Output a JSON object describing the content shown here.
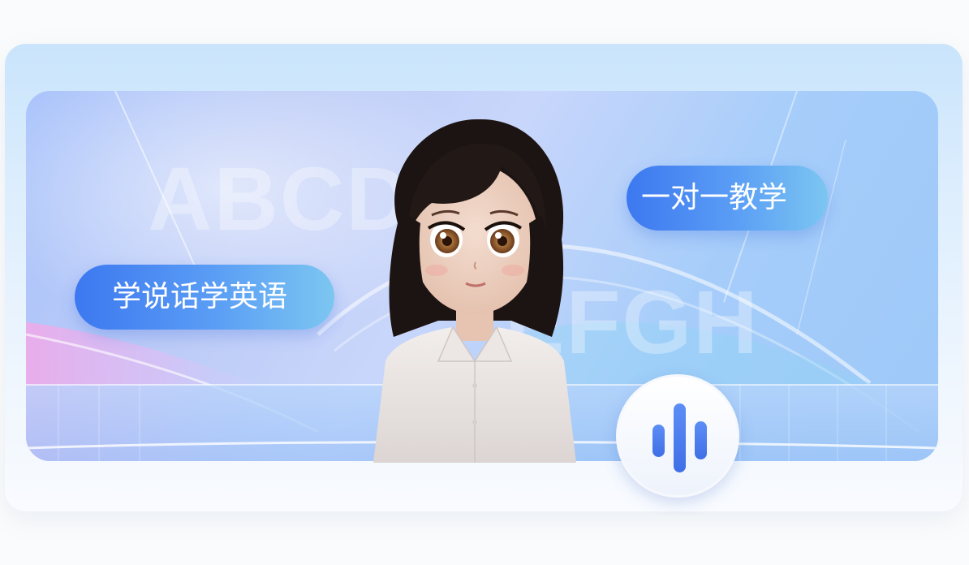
{
  "banner": {
    "bg_letters_top": "ABCD",
    "bg_letters_bottom": "EFGH",
    "tag_left": "学说话学英语",
    "tag_right": "一对一教学"
  },
  "voice_button": {
    "icon": "voice-wave-icon",
    "color": "#4a7ff0"
  },
  "avatar": {
    "description": "cartoon-teacher-avatar"
  },
  "colors": {
    "bubble_start": "#3c78f0",
    "bubble_end": "#7cc6f1",
    "card_bg": "#c9e4fc"
  }
}
